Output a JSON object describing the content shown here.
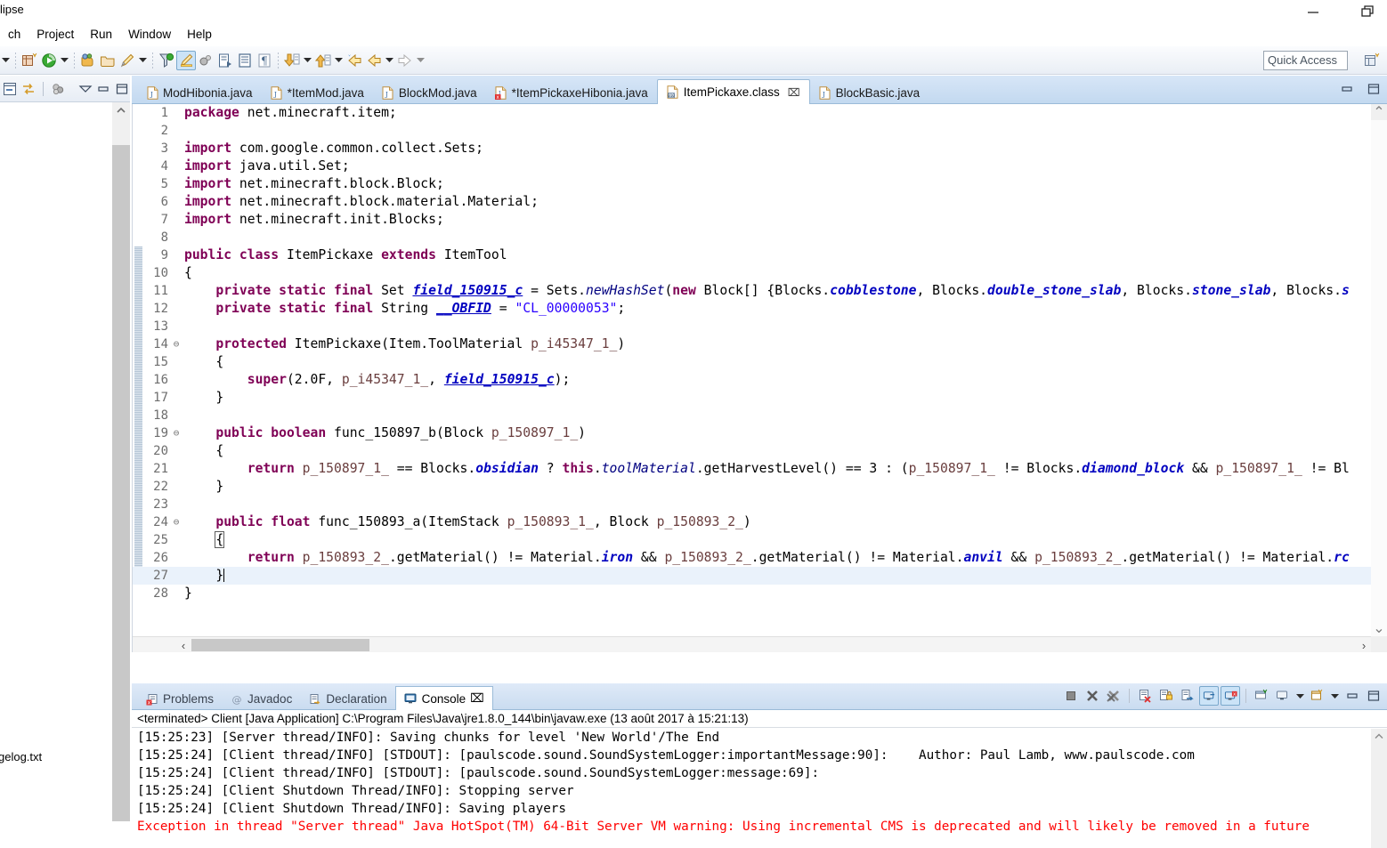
{
  "window": {
    "title": "lipse",
    "buttons": [
      "minimize-button",
      "restore-button"
    ]
  },
  "menubar": {
    "items": [
      "ch",
      "Project",
      "Run",
      "Window",
      "Help"
    ]
  },
  "toolbar": {
    "quick_access_placeholder": "Quick Access",
    "icons": [
      "dropdown-arrow",
      "new-wizard-icon",
      "run-icon",
      "run-dropdown-arrow",
      "debug-icon",
      "open-type-icon",
      "pencil-icon",
      "pencil-dropdown-arrow",
      "search-icon",
      "highlight-icon",
      "skip-breakpoints-icon",
      "next-annotation-icon",
      "previous-edit-icon",
      "pilcrow-icon",
      "down-arrow-icon",
      "down-dropdown-arrow",
      "up-arrow-icon",
      "up-dropdown-arrow",
      "back-history-icon",
      "back-icon",
      "back-dropdown-arrow",
      "forward-icon",
      "forward-dropdown-arrow"
    ],
    "perspective_icon": "open-perspective-icon"
  },
  "left_panel": {
    "toolbar_icons": [
      "collapse-all-icon",
      "link-with-editor-icon",
      "view-menu-icon",
      "minimize-icon",
      "maximize-icon"
    ],
    "file_label": "gelog.txt"
  },
  "editor": {
    "tabs": [
      {
        "label": "ModHibonia.java",
        "icon": "java-file-icon",
        "active": false,
        "dirty": false,
        "closable": false
      },
      {
        "label": "*ItemMod.java",
        "icon": "java-file-icon",
        "active": false,
        "dirty": true,
        "closable": false
      },
      {
        "label": "BlockMod.java",
        "icon": "java-file-icon",
        "active": false,
        "dirty": false,
        "closable": false
      },
      {
        "label": "*ItemPickaxeHibonia.java",
        "icon": "java-error-icon",
        "active": false,
        "dirty": true,
        "closable": false
      },
      {
        "label": "ItemPickaxe.class",
        "icon": "class-file-icon",
        "active": true,
        "dirty": false,
        "closable": true
      },
      {
        "label": "BlockBasic.java",
        "icon": "java-file-icon",
        "active": false,
        "dirty": false,
        "closable": false
      }
    ],
    "tab_close_glyph": "⌧",
    "minimize_label": "minimize-icon",
    "maximize_label": "maximize-icon",
    "lines": [
      {
        "n": "1",
        "fold": "",
        "html": "<span class=\"kw\">package</span> net.minecraft.item;"
      },
      {
        "n": "2",
        "fold": "",
        "html": ""
      },
      {
        "n": "3",
        "fold": "",
        "html": "<span class=\"kw\">import</span> com.google.common.collect.Sets;"
      },
      {
        "n": "4",
        "fold": "",
        "html": "<span class=\"kw\">import</span> java.util.Set;"
      },
      {
        "n": "5",
        "fold": "",
        "html": "<span class=\"kw\">import</span> net.minecraft.block.Block;"
      },
      {
        "n": "6",
        "fold": "",
        "html": "<span class=\"kw\">import</span> net.minecraft.block.material.Material;"
      },
      {
        "n": "7",
        "fold": "",
        "html": "<span class=\"kw\">import</span> net.minecraft.init.Blocks;"
      },
      {
        "n": "8",
        "fold": "",
        "html": ""
      },
      {
        "n": "9",
        "fold": "",
        "html": "<span class=\"kw\">public</span> <span class=\"kw\">class</span> ItemPickaxe <span class=\"kw\">extends</span> ItemTool"
      },
      {
        "n": "10",
        "fold": "",
        "html": "{"
      },
      {
        "n": "11",
        "fold": "",
        "html": "    <span class=\"kw\">private</span> <span class=\"kw\">static</span> <span class=\"kw\">final</span> Set <span class=\"sfld\">field_150915_c</span> = Sets.<span class=\"mth\">newHashSet</span>(<span class=\"kw\">new</span> Block[] {Blocks.<span class=\"fld\">cobblestone</span>, Blocks.<span class=\"fld\">double_stone_slab</span>, Blocks.<span class=\"fld\">stone_slab</span>, Blocks.<span class=\"fld\">s</span>"
      },
      {
        "n": "12",
        "fold": "",
        "html": "    <span class=\"kw\">private</span> <span class=\"kw\">static</span> <span class=\"kw\">final</span> String <span class=\"sfld\">__OBFID</span> = <span class=\"str\">\"CL_00000053\"</span>;"
      },
      {
        "n": "13",
        "fold": "",
        "html": ""
      },
      {
        "n": "14",
        "fold": "⊖",
        "html": "    <span class=\"kw\">protected</span> ItemPickaxe(Item.ToolMaterial <span class=\"prm\">p_i45347_1_</span>)"
      },
      {
        "n": "15",
        "fold": "",
        "html": "    {"
      },
      {
        "n": "16",
        "fold": "",
        "html": "        <span class=\"kw\">super</span>(2.0F, <span class=\"prm\">p_i45347_1_</span>, <span class=\"sfld\">field_150915_c</span>);"
      },
      {
        "n": "17",
        "fold": "",
        "html": "    }"
      },
      {
        "n": "18",
        "fold": "",
        "html": ""
      },
      {
        "n": "19",
        "fold": "⊖",
        "html": "    <span class=\"kw\">public</span> <span class=\"kw\">boolean</span> func_150897_b(Block <span class=\"prm\">p_150897_1_</span>)"
      },
      {
        "n": "20",
        "fold": "",
        "html": "    {"
      },
      {
        "n": "21",
        "fold": "",
        "html": "        <span class=\"kw\">return</span> <span class=\"prm\">p_150897_1_</span> == Blocks.<span class=\"fld\">obsidian</span> ? <span class=\"kw\">this</span>.<span class=\"mth\">toolMaterial</span>.getHarvestLevel() == 3 : (<span class=\"prm\">p_150897_1_</span> != Blocks.<span class=\"fld\">diamond_block</span> &amp;&amp; <span class=\"prm\">p_150897_1_</span> != Bl"
      },
      {
        "n": "22",
        "fold": "",
        "html": "    }"
      },
      {
        "n": "23",
        "fold": "",
        "html": ""
      },
      {
        "n": "24",
        "fold": "⊖",
        "html": "    <span class=\"kw\">public</span> <span class=\"kw\">float</span> func_150893_a(ItemStack <span class=\"prm\">p_150893_1_</span>, Block <span class=\"prm\">p_150893_2_</span>)"
      },
      {
        "n": "25",
        "fold": "",
        "html": "    <span class=\"brace-box\">{</span>"
      },
      {
        "n": "26",
        "fold": "",
        "html": "        <span class=\"kw\">return</span> <span class=\"prm\">p_150893_2_</span>.getMaterial() != Material.<span class=\"fld\">iron</span> &amp;&amp; <span class=\"prm\">p_150893_2_</span>.getMaterial() != Material.<span class=\"fld\">anvil</span> &amp;&amp; <span class=\"prm\">p_150893_2_</span>.getMaterial() != Material.<span class=\"fld\">rc</span>"
      },
      {
        "n": "27",
        "fold": "",
        "html": "    }<span class=\"cursorbar\"></span>",
        "highlight": true
      },
      {
        "n": "28",
        "fold": "",
        "html": "}"
      }
    ],
    "hscroll": {
      "left_arrow": "‹",
      "right_arrow": "›"
    },
    "vscroll": {
      "up_arrow": "⌃",
      "down_arrow": "⌄"
    }
  },
  "console": {
    "tabs": [
      {
        "label": "Problems",
        "icon": "problems-icon",
        "active": false,
        "closable": false
      },
      {
        "label": "Javadoc",
        "icon": "javadoc-icon",
        "active": false,
        "closable": false
      },
      {
        "label": "Declaration",
        "icon": "declaration-icon",
        "active": false,
        "closable": false
      },
      {
        "label": "Console",
        "icon": "console-icon",
        "active": true,
        "closable": true
      }
    ],
    "close_glyph": "⌧",
    "header": "<terminated> Client [Java Application] C:\\Program Files\\Java\\jre1.8.0_144\\bin\\javaw.exe (13 août 2017 à 15:21:13)",
    "tools": [
      "terminate-icon",
      "remove-launch-icon",
      "remove-all-terminated-icon",
      "clear-console-icon",
      "scroll-lock-icon",
      "pin-console-icon",
      "display-selected-console-icon",
      "open-console-icon",
      "new-console-view-icon",
      "open-console-dropdown-arrow",
      "console-menu-icon",
      "console-menu-dropdown-arrow",
      "minimize-icon",
      "maximize-icon"
    ],
    "output": [
      {
        "text": "[15:25:23] [Server thread/INFO]: Saving chunks for level 'New World'/The End",
        "error": false
      },
      {
        "text": "[15:25:24] [Client thread/INFO] [STDOUT]: [paulscode.sound.SoundSystemLogger:importantMessage:90]:    Author: Paul Lamb, www.paulscode.com",
        "error": false
      },
      {
        "text": "[15:25:24] [Client thread/INFO] [STDOUT]: [paulscode.sound.SoundSystemLogger:message:69]:",
        "error": false
      },
      {
        "text": "[15:25:24] [Client Shutdown Thread/INFO]: Stopping server",
        "error": false
      },
      {
        "text": "[15:25:24] [Client Shutdown Thread/INFO]: Saving players",
        "error": false
      },
      {
        "text": "Exception in thread \"Server thread\" Java HotSpot(TM) 64-Bit Server VM warning: Using incremental CMS is deprecated and will likely be removed in a future",
        "error": true
      }
    ]
  },
  "colors": {
    "keyword": "#7f0055",
    "string": "#2a00ff",
    "field": "#0000c0",
    "parameter": "#6a3e3e",
    "error": "#ff0000",
    "tab_active_bg": "#ffffff",
    "tab_bar_bg": "#c3d9f0"
  }
}
